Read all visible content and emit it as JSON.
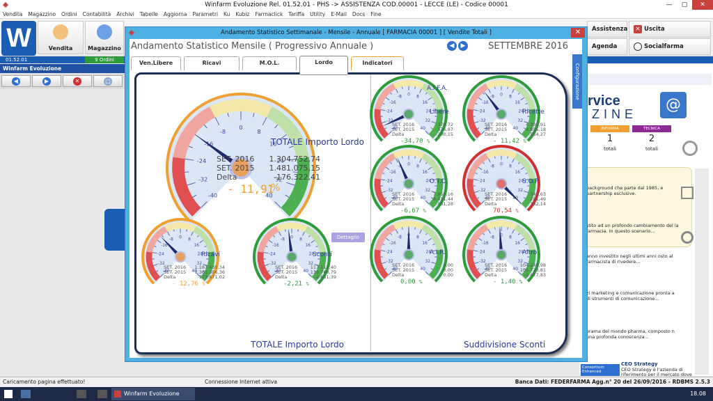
{
  "window": {
    "title": "Winfarm Evoluzione Rel. 01.52.01 - PHS -> ASSISTENZA COD.00001 - LECCE (LE) - Codice 00001",
    "min": "—",
    "max": "▢",
    "close": "✕"
  },
  "menu": [
    "Vendita",
    "Magazzino",
    "Ordini",
    "Contabilità",
    "Archivi",
    "Tabelle",
    "Aggiorna",
    "Parametri",
    "Ku",
    "Kubiz",
    "Farmaclick",
    "Tariffa",
    "Utility",
    "E-Mail",
    "Docs",
    "Fine"
  ],
  "ribbon": {
    "logo": "W",
    "vendita": "Vendita",
    "magazzino": "Magazzino",
    "assistenza": "Assistenza",
    "uscita": "Uscita",
    "agenda": "Agenda",
    "socialfarma": "Socialfarma"
  },
  "subbar": {
    "version": "01.52.01",
    "ordini": "9 Ordini"
  },
  "left": {
    "title": "Winfarm Evoluzione"
  },
  "right": {
    "logo_text": "rvice",
    "logo_sub": "ZINE",
    "cards": [
      {
        "label": "INFORMA",
        "count": "1",
        "total": "totali",
        "color": "#f0a030"
      },
      {
        "label": "TECNICA",
        "count": "2",
        "total": "totali",
        "color": "#8e2a96"
      }
    ],
    "news": [
      "background che parte dal 1985, e partnership esclusive.",
      "stito ad un profondo cambiamento del la farmacia. In questo scenario...",
      "anno investito negli ultimi anni osto al farmacista di rivedere...",
      "zi marketing e comunicazione pronta a di strumenti di comunicazione...",
      "orama del mondo pharma, composto n una profonda conoscenza..."
    ],
    "ceo_title": "CEO Strategy",
    "ceo_text": "CEO Strategy è l'azienda di riferimento per il mercato dove incontrare",
    "consortium": "Consortium",
    "enhanced": "Enhanced"
  },
  "dialog": {
    "title": "Andamento Statistico Settimanale - Mensile - Annuale [ FARMACIA 00001 ] [ Vendite Totali ]",
    "heading": "Andamento Statistico Mensile  ( Progressivo Annuale )",
    "month": "SETTEMBRE 2016",
    "tabs": [
      "Ven.Libere",
      "Ricavi",
      "M.O.L.",
      "Lordo",
      "Indicatori"
    ],
    "config_tab": "Configurazione",
    "dettaglio": "Dettaglio",
    "section_left": "TOTALE Importo Lordo",
    "section_right": "Suddivisione Sconti",
    "main": {
      "label": "TOTALE Importo Lordo",
      "rows": [
        "SET. 2016",
        "SET. 2015",
        "Delta"
      ],
      "values": [
        "1.304.752,74",
        "1.481.075,15",
        "-176.322,41"
      ],
      "pct": "- 11,91",
      "pct_sym": "%",
      "needle": -16,
      "color": "#f0a030"
    },
    "small": [
      {
        "name": "Ricavi",
        "values": [
          "1.187.635,34",
          "1.361.306,36",
          "-173.671,02"
        ],
        "pct": "- 12,76",
        "needle": -13,
        "color": "#f0a030",
        "pctcolor": "#f0a030"
      },
      {
        "name": "Sconti",
        "values": [
          "117.117,40",
          "119.768,79",
          "-2.651,39"
        ],
        "pct": "-2,21",
        "needle": -2,
        "color": "#2f9c3a",
        "pctcolor": "#2f9c3a"
      },
      {
        "name": "Libere",
        "title": "A.I.F.A.",
        "values": [
          "376,72",
          "576,87",
          "-200,15"
        ],
        "pct": "-34,70",
        "needle": -34,
        "color": "#2f9c3a",
        "pctcolor": "#2f9c3a"
      },
      {
        "name": "Ricette",
        "values": [
          "4.300,91",
          "4.855,18",
          "-554,27"
        ],
        "pct": "- 11,42",
        "needle": -11,
        "color": "#2f9c3a",
        "pctcolor": "#2f9c3a"
      },
      {
        "name": "O.T.C.",
        "values": [
          "7.850,16",
          "8.411,44",
          "-561,28"
        ],
        "pct": "-6,67",
        "needle": -7,
        "color": "#2f9c3a",
        "pctcolor": "#2f9c3a"
      },
      {
        "name": "S.O.P",
        "values": [
          "343,63",
          "201,49",
          "142,14"
        ],
        "pct": "70,54",
        "needle": 40,
        "color": "#d23030",
        "pctcolor": "#d23030"
      },
      {
        "name": "A.I.R.",
        "values": [
          "0,00",
          "0,00",
          "0,00"
        ],
        "pct": "0,00",
        "needle": 0,
        "color": "#2f9c3a",
        "pctcolor": "#2f9c3a"
      },
      {
        "name": "Altro",
        "values": [
          "104.245,98",
          "105.723,81",
          "-1.477,83"
        ],
        "pct": "- 1,40",
        "needle": -1,
        "color": "#2f9c3a",
        "pctcolor": "#2f9c3a"
      }
    ],
    "small_rows": [
      "SET. 2016",
      "SET. 2015",
      "Delta"
    ],
    "ticks": [
      "-40",
      "-32",
      "-24",
      "-16",
      "-8",
      "0",
      "8",
      "16",
      "24",
      "32",
      "40"
    ]
  },
  "status": {
    "left": "Caricamento pagina effettuato!",
    "mid": "Connessione Internet attiva",
    "right": "Banca Dati: FEDERFARMA Agg.n° 20 del 26/09/2016 - RDBMS 2.5.3"
  },
  "taskbar": {
    "app": "Winfarm Evoluzione",
    "time": "18.08"
  }
}
